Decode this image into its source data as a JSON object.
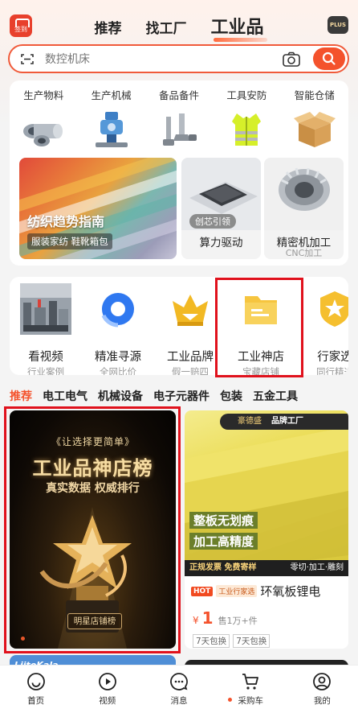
{
  "header": {
    "signin_label": "签到",
    "tabs": [
      {
        "label": "推荐"
      },
      {
        "label": "找工厂"
      },
      {
        "label": "工业品"
      }
    ],
    "plus_label": "PLUS"
  },
  "search": {
    "placeholder": "数控机床",
    "scan_icon": "scan-icon",
    "camera_icon": "camera-icon",
    "search_icon": "search-icon"
  },
  "categories": [
    {
      "label": "生产物料"
    },
    {
      "label": "生产机械"
    },
    {
      "label": "备品备件"
    },
    {
      "label": "工具安防"
    },
    {
      "label": "智能仓储"
    }
  ],
  "banners": {
    "main": {
      "title": "纺织趋势指南",
      "sub": "服装家纺 鞋靴箱包"
    },
    "compute": {
      "tag": "创芯引领",
      "title": "算力驱动"
    },
    "precision": {
      "title": "精密机加工",
      "sub": "CNC加工"
    }
  },
  "features": [
    {
      "title": "看视频",
      "sub": "行业案例"
    },
    {
      "title": "精准寻源",
      "sub": "全网比价"
    },
    {
      "title": "工业品牌",
      "sub": "假一赔四"
    },
    {
      "title": "工业神店",
      "sub": "宝藏店铺"
    },
    {
      "title": "行家选",
      "sub": "同行精选"
    }
  ],
  "category_tabs": [
    {
      "label": "推荐"
    },
    {
      "label": "电工电气"
    },
    {
      "label": "机械设备"
    },
    {
      "label": "电子元器件"
    },
    {
      "label": "包装"
    },
    {
      "label": "五金工具"
    }
  ],
  "feed": {
    "left": {
      "top_text": "让选择更简单",
      "title": "工业品神店榜",
      "sub": "真实数据 权威排行",
      "button": "明星店铺榜"
    },
    "right": {
      "brand": "豪德盛",
      "brand_tag": "品牌工厂",
      "badge1": "整板无划痕",
      "badge2": "加工高精度",
      "band_left": "正规发票 免费寄样",
      "band_right": "零切·加工·雕刻",
      "hot": "HOT",
      "select_tag": "工业行家选",
      "title": "环氧板锂电",
      "currency": "¥",
      "price": "1",
      "sold": "售1万+件",
      "tags": [
        "7天包换",
        "7天包换"
      ]
    },
    "peek_left": "LiitoKala"
  },
  "bottom_nav": [
    {
      "label": "首页",
      "icon": "home-icon"
    },
    {
      "label": "视频",
      "icon": "video-icon"
    },
    {
      "label": "消息",
      "icon": "message-icon"
    },
    {
      "label": "采购车",
      "icon": "cart-icon"
    },
    {
      "label": "我的",
      "icon": "profile-icon"
    }
  ],
  "colors": {
    "accent": "#f4522c",
    "highlight_box": "#e0111c"
  }
}
